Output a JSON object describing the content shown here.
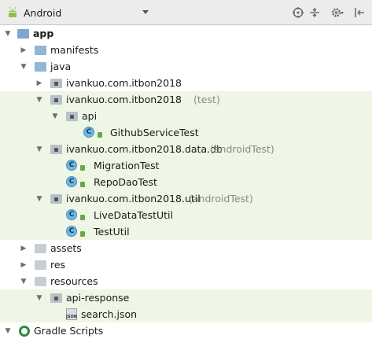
{
  "toolbar": {
    "view_mode": "Android",
    "icons": [
      "android-icon",
      "dropdown-arrow-icon",
      "scope-target-icon",
      "collapse-all-icon",
      "settings-gear-icon",
      "hide-panel-icon"
    ]
  },
  "tree": {
    "app": "app",
    "manifests": "manifests",
    "java": "java",
    "pkg_main": "ivankuo.com.itbon2018",
    "pkg_test": "ivankuo.com.itbon2018",
    "pkg_test_hint": "(test)",
    "api": "api",
    "github_service_test": "GithubServiceTest",
    "pkg_data_db": "ivankuo.com.itbon2018.data.db",
    "pkg_data_db_hint": "(androidTest)",
    "migration_test": "MigrationTest",
    "repo_dao_test": "RepoDaoTest",
    "pkg_util": "ivankuo.com.itbon2018.util",
    "pkg_util_hint": "(androidTest)",
    "livedata_test_util": "LiveDataTestUtil",
    "test_util": "TestUtil",
    "assets": "assets",
    "res": "res",
    "resources": "resources",
    "api_response": "api-response",
    "search_json": "search.json",
    "gradle_scripts": "Gradle Scripts",
    "class_badge": "C",
    "json_badge": "JSON"
  },
  "colors": {
    "test_row_highlight": "#eef6e6",
    "class_icon": "#6fb6e0",
    "lock_badge": "#6aa74c",
    "android_green": "#8bc34a"
  }
}
